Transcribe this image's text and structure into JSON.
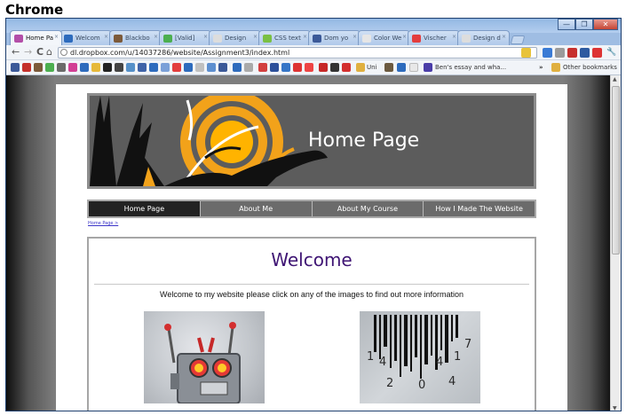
{
  "caption": "Chrome",
  "window": {
    "controls": [
      "minimize",
      "maximize",
      "close"
    ]
  },
  "tabs": [
    {
      "label": "Home Pa",
      "favicon_color": "#b34ea8",
      "active": true
    },
    {
      "label": "Welcom",
      "favicon_color": "#2d6bbd",
      "active": false
    },
    {
      "label": "Blackbo",
      "favicon_color": "#7c5a3a",
      "active": false
    },
    {
      "label": "[Valid]",
      "favicon_color": "#4caf50",
      "active": false
    },
    {
      "label": "Design",
      "favicon_color": "#dddddd",
      "active": false
    },
    {
      "label": "CSS text",
      "favicon_color": "#7ac043",
      "active": false
    },
    {
      "label": "Dom yo",
      "favicon_color": "#3b5998",
      "active": false
    },
    {
      "label": "Color We",
      "favicon_color": "#e6e6e6",
      "active": false
    },
    {
      "label": "Vischer",
      "favicon_color": "#e33d3d",
      "active": false
    },
    {
      "label": "Design d",
      "favicon_color": "#dddddd",
      "active": false
    }
  ],
  "toolbar": {
    "back": "←",
    "forward": "→",
    "reload": "C",
    "home": "⌂",
    "url": "dl.dropbox.com/u/14037286/website/Assignment3/index.html"
  },
  "bookmarks": {
    "folder_label": "Uni",
    "item_label": "Ben's essay and wha...",
    "overflow": "»",
    "other_bookmarks": "Other bookmarks"
  },
  "page": {
    "banner_title": "Home Page",
    "nav_items": [
      "Home Page",
      "About Me",
      "About My Course",
      "How I Made The Website"
    ],
    "active_nav": 0,
    "breadcrumb": "Home Page >",
    "welcome_heading": "Welcome",
    "intro_text": "Welcome to my website please click on any of the images to find out more information",
    "barcode_digits": [
      "1",
      "4",
      "2",
      "0",
      "4",
      "1",
      "4",
      "7"
    ]
  },
  "colors": {
    "accent_heading": "#3f1574",
    "nav_bar": "#6b6b6b",
    "nav_active": "#222222",
    "banner_orange": "#f2a21a",
    "window_frame": "#9fbde3"
  }
}
